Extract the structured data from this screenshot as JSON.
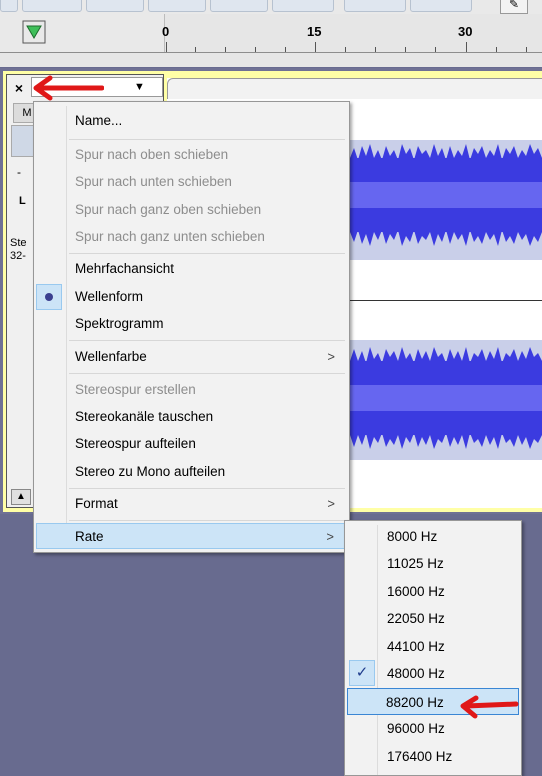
{
  "ruler": {
    "ticks": [
      "0",
      "15",
      "30"
    ]
  },
  "track": {
    "channel_letter_m": "M",
    "minus_label": "-",
    "left_label": "L",
    "info_line1": "Ste",
    "info_line2": "32-",
    "close_label": "×",
    "dropdown_glyph": "▼",
    "collapse_glyph": "▲"
  },
  "menu": {
    "name": "Name...",
    "move_up": "Spur nach oben schieben",
    "move_down": "Spur nach unten schieben",
    "move_top": "Spur nach ganz oben schieben",
    "move_bottom": "Spur nach ganz unten schieben",
    "multiview": "Mehrfachansicht",
    "waveform": "Wellenform",
    "spectrogram": "Spektrogramm",
    "wave_color": "Wellenfarbe",
    "make_stereo": "Stereospur erstellen",
    "swap_channels": "Stereokanäle tauschen",
    "split_stereo": "Stereospur aufteilen",
    "split_mono": "Stereo zu Mono aufteilen",
    "format": "Format",
    "rate": "Rate",
    "chevron": ">"
  },
  "rate_submenu": {
    "items": [
      "8000 Hz",
      "11025 Hz",
      "16000 Hz",
      "22050 Hz",
      "44100 Hz",
      "48000 Hz",
      "88200 Hz",
      "96000 Hz",
      "176400 Hz"
    ],
    "checked": "48000 Hz",
    "hovered": "88200 Hz",
    "check_glyph": "✓"
  }
}
